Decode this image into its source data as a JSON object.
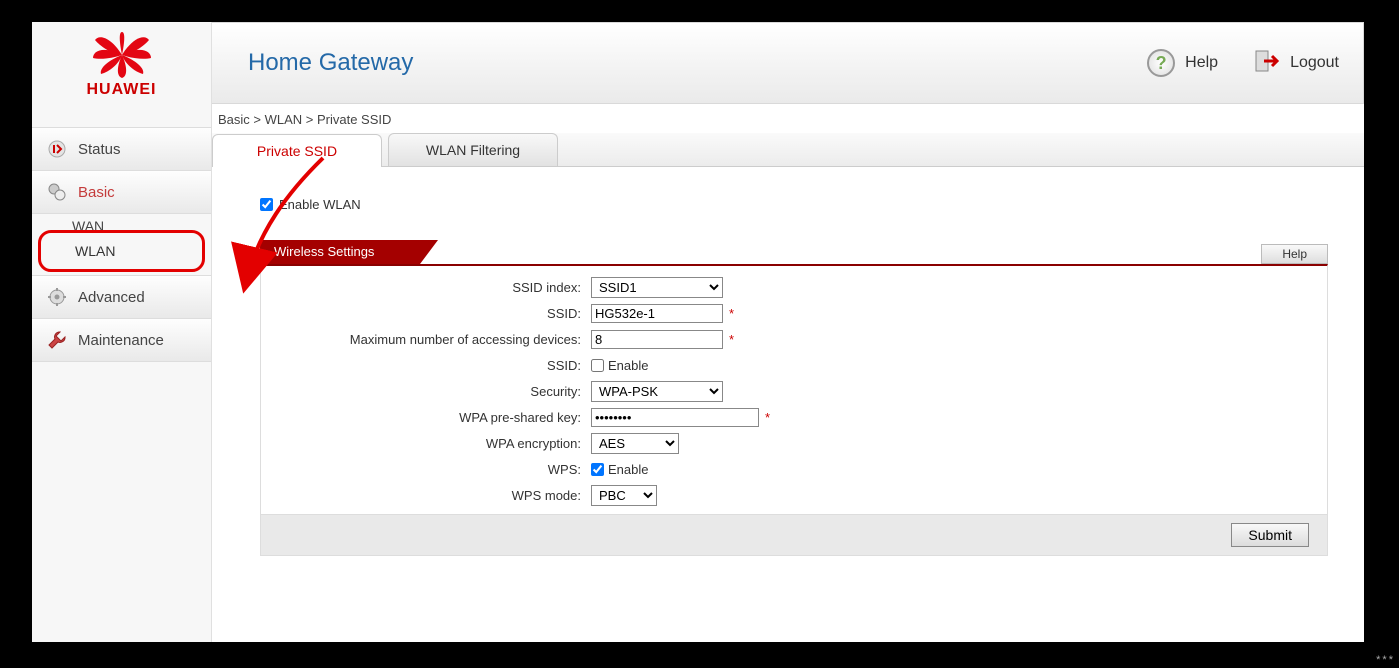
{
  "brand": "HUAWEI",
  "header": {
    "title": "Home Gateway",
    "help": "Help",
    "logout": "Logout"
  },
  "nav": {
    "status": "Status",
    "basic": "Basic",
    "wan_partial": "WAN",
    "wlan": "WLAN",
    "advanced": "Advanced",
    "maintenance": "Maintenance"
  },
  "breadcrumb": "Basic > WLAN > Private SSID",
  "tabs": {
    "private_ssid": "Private SSID",
    "wlan_filtering": "WLAN Filtering"
  },
  "enable_wlan_label": "Enable WLAN",
  "panel": {
    "title": "Wireless Settings",
    "help": "Help"
  },
  "form": {
    "ssid_index_label": "SSID index:",
    "ssid_index_value": "SSID1",
    "ssid_label": "SSID:",
    "ssid_value": "HG532e-1",
    "max_devices_label": "Maximum number of accessing devices:",
    "max_devices_value": "8",
    "ssid_enable_label": "SSID:",
    "ssid_enable_text": "Enable",
    "security_label": "Security:",
    "security_value": "WPA-PSK",
    "wpa_key_label": "WPA pre-shared key:",
    "wpa_key_value": "••••••••",
    "wpa_enc_label": "WPA encryption:",
    "wpa_enc_value": "AES",
    "wps_label": "WPS:",
    "wps_enable_text": "Enable",
    "wps_mode_label": "WPS mode:",
    "wps_mode_value": "PBC",
    "required_mark": "*"
  },
  "submit": "Submit"
}
